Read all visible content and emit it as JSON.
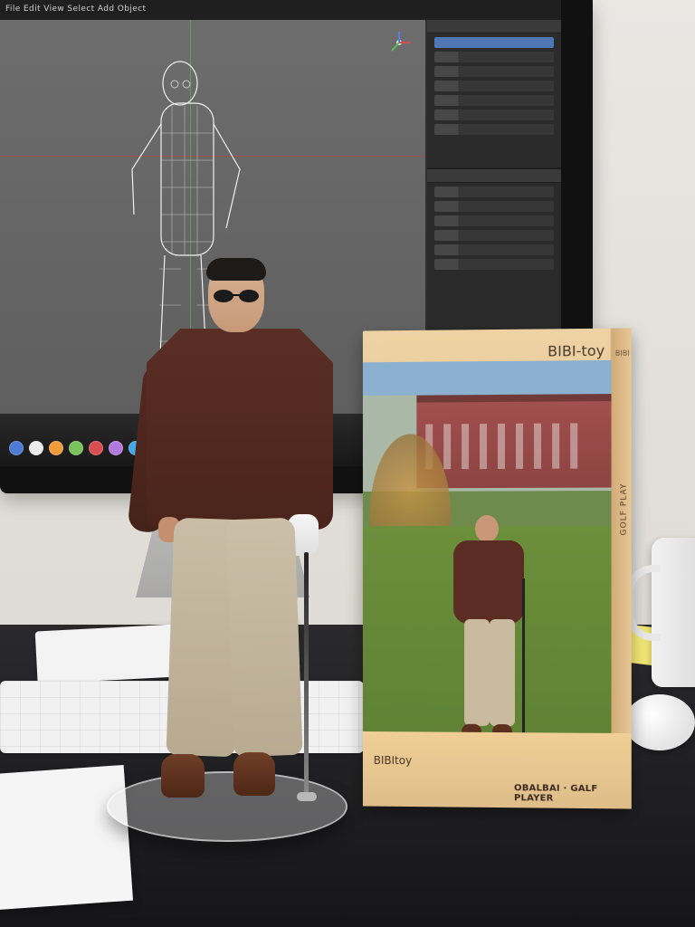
{
  "box": {
    "brand_main": "BIBI",
    "brand_suffix": "-toy",
    "brand_side": "BIBI",
    "bottom_brand_main": "BIBI",
    "bottom_brand_suffix": "toy",
    "product_name": "OBALBAI · GALF PLAYER",
    "side_text": "GOLF PLAY"
  },
  "screen": {
    "menu_text": "File Edit View Select Add Object"
  },
  "colors": {
    "sweater": "#4a241c",
    "pants": "#bfae93",
    "box": "#e2c08f"
  },
  "icons": {
    "gizmo": "axis-gizmo-icon"
  }
}
